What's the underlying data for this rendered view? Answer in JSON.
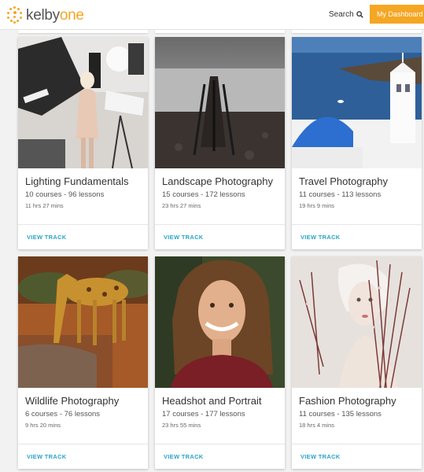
{
  "header": {
    "logo_left": "kelby",
    "logo_right": "one",
    "search_label": "Search",
    "dashboard_label": "My Dashboard",
    "accent_color": "#f5a623"
  },
  "tracks": [
    {
      "title": "Lighting Fundamentals",
      "meta": "10 courses - 96 lessons",
      "duration": "11 hrs 27 mins",
      "link": "VIEW TRACK"
    },
    {
      "title": "Landscape Photography",
      "meta": "15 courses - 172 lessons",
      "duration": "23 hrs 27 mins",
      "link": "VIEW TRACK"
    },
    {
      "title": "Travel Photography",
      "meta": "11 courses - 113 lessons",
      "duration": "19 hrs 9 mins",
      "link": "VIEW TRACK"
    },
    {
      "title": "Wildlife Photography",
      "meta": "6 courses - 76 lessons",
      "duration": "9 hrs 20 mins",
      "link": "VIEW TRACK"
    },
    {
      "title": "Headshot and Portrait",
      "meta": "17 courses - 177 lessons",
      "duration": "23 hrs 55 mins",
      "link": "VIEW TRACK"
    },
    {
      "title": "Fashion Photography",
      "meta": "11 courses - 135 lessons",
      "duration": "18 hrs 4 mins",
      "link": "VIEW TRACK"
    }
  ],
  "link_color": "#2aa4c9"
}
